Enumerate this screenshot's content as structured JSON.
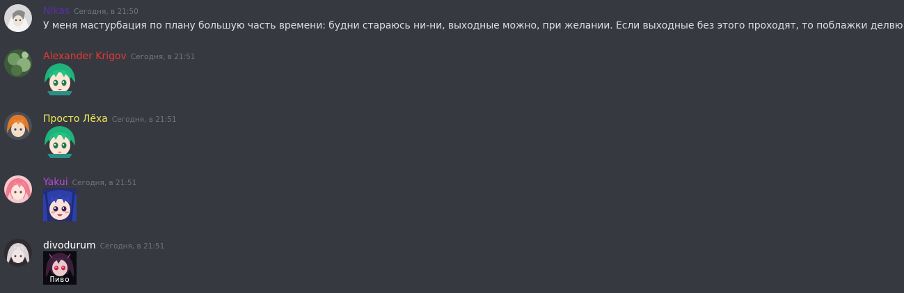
{
  "messages": [
    {
      "username": "Nikas",
      "username_color": "#5b2fa8",
      "timestamp": "Сегодня, в 21:50",
      "text": "У меня мастурбация по плану большую часть времени: будни стараюсь ни-ни, выходные можно, при желании. Если выходные без этого проходят, то поблажки делвю"
    },
    {
      "username": "Alexander Krigov",
      "username_color": "#e53935",
      "timestamp": "Сегодня, в 21:51",
      "sticker": "green-hair-anime-face"
    },
    {
      "username": "Просто Лёха",
      "username_color": "#f1e85a",
      "timestamp": "Сегодня, в 21:51",
      "sticker": "green-hair-anime-face"
    },
    {
      "username": "Yakui",
      "username_color": "#b44be1",
      "timestamp": "Сегодня, в 21:51",
      "sticker": "blue-hair-anime-face"
    },
    {
      "username": "divodurum",
      "username_color": "#ffffff",
      "timestamp": "Сегодня, в 21:51",
      "sticker": "dark-anime-pivo",
      "sticker_caption": "Пиво"
    }
  ]
}
